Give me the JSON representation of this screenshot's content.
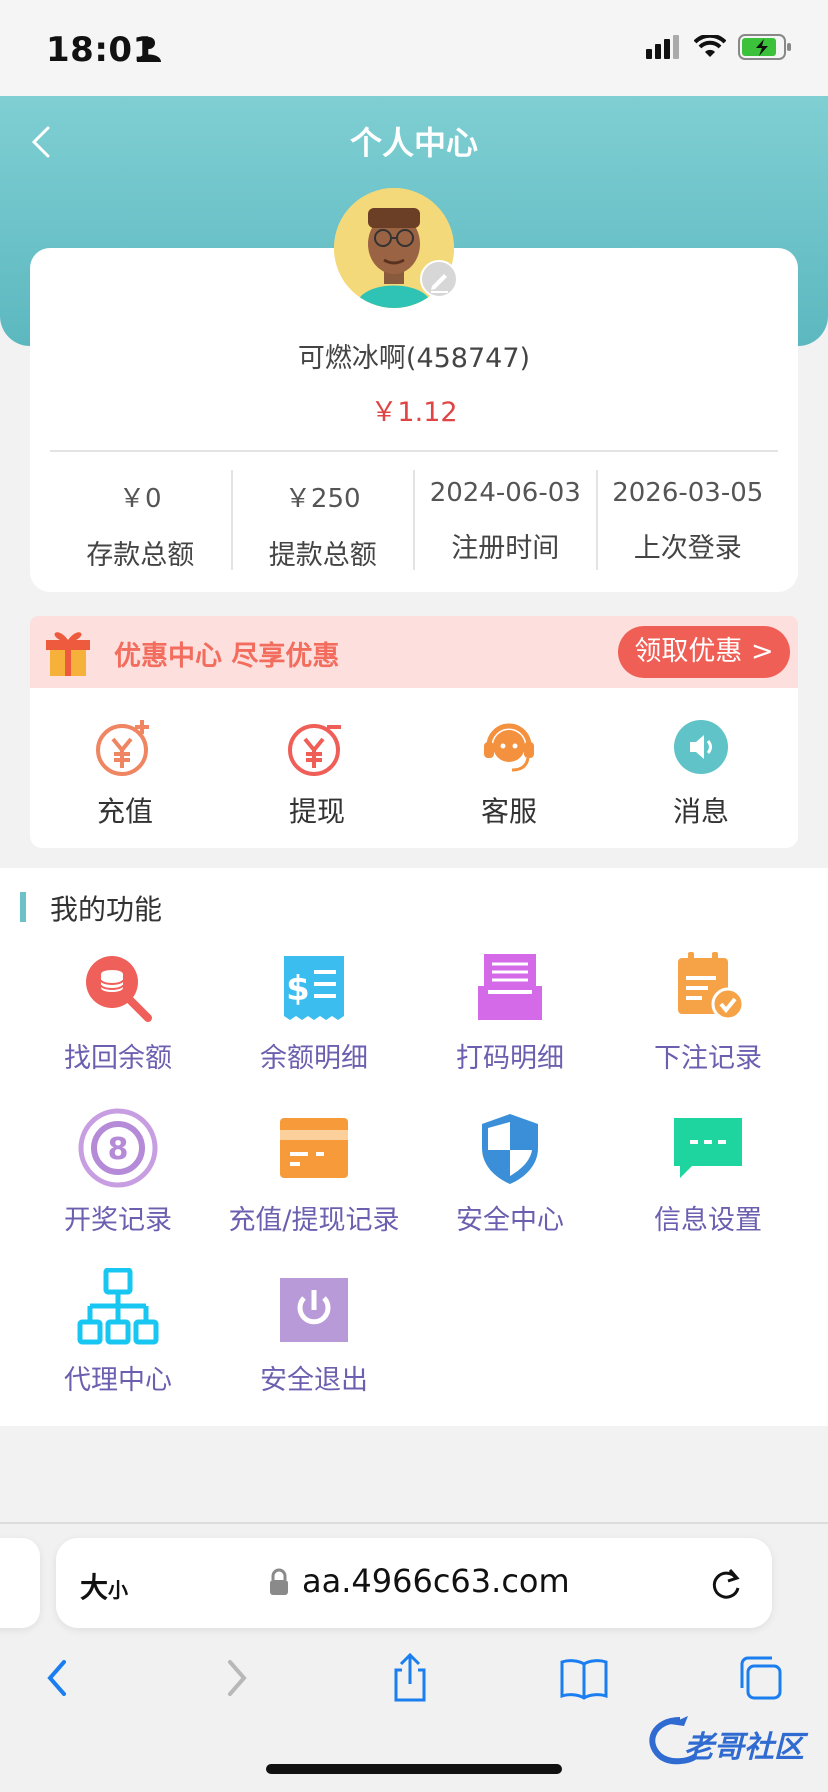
{
  "status_bar": {
    "time": "18:01"
  },
  "header": {
    "title": "个人中心"
  },
  "profile": {
    "username": "可燃冰啊(458747)",
    "balance": "￥1.12",
    "stats": [
      {
        "value": "￥0",
        "label": "存款总额"
      },
      {
        "value": "￥250",
        "label": "提款总额"
      },
      {
        "value": "2024-06-03",
        "label": "注册时间"
      },
      {
        "value": "2026-03-05",
        "label": "上次登录"
      }
    ]
  },
  "promo": {
    "text": "优惠中心 尽享优惠",
    "button": "领取优惠 >"
  },
  "quick_actions": [
    {
      "label": "充值",
      "icon": "recharge-icon"
    },
    {
      "label": "提现",
      "icon": "withdraw-icon"
    },
    {
      "label": "客服",
      "icon": "customer-service-icon"
    },
    {
      "label": "消息",
      "icon": "speaker-icon"
    }
  ],
  "functions": {
    "title": "我的功能",
    "items": [
      {
        "label": "找回余额",
        "icon": "search-balance-icon"
      },
      {
        "label": "余额明细",
        "icon": "receipt-icon"
      },
      {
        "label": "打码明细",
        "icon": "printer-icon"
      },
      {
        "label": "下注记录",
        "icon": "clipboard-check-icon"
      },
      {
        "label": "开奖记录",
        "icon": "ball-8-icon"
      },
      {
        "label": "充值/提现记录",
        "icon": "card-icon"
      },
      {
        "label": "安全中心",
        "icon": "shield-icon"
      },
      {
        "label": "信息设置",
        "icon": "message-icon"
      },
      {
        "label": "代理中心",
        "icon": "org-chart-icon"
      },
      {
        "label": "安全退出",
        "icon": "power-icon"
      }
    ]
  },
  "browser": {
    "text_size": "大",
    "text_size_small": "小",
    "url": "aa.4966c63.com"
  },
  "watermark": {
    "text": "老哥社区"
  },
  "colors": {
    "header": "#6dc2c8",
    "accent_red": "#f05f55",
    "func_label": "#6d5fb0"
  }
}
